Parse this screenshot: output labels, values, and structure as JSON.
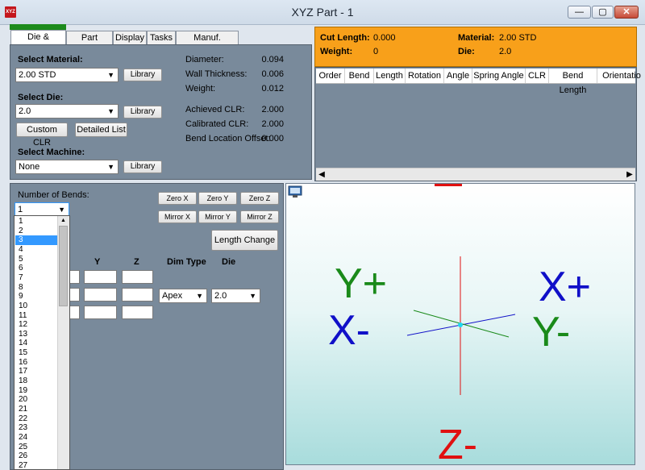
{
  "window": {
    "title": "XYZ Part - 1",
    "icon_text": "XYZ",
    "minimize": "—",
    "maximize": "▢",
    "close": "✕"
  },
  "tabs": [
    "Die & Material",
    "Part Details",
    "Display",
    "Tasks",
    "Manuf. Warning"
  ],
  "material_section": {
    "select_material_label": "Select Material:",
    "material_value": "2.00 STD",
    "library_label": "Library",
    "select_die_label": "Select Die:",
    "die_value": "2.0",
    "custom_clr_label": "Custom CLR",
    "detailed_list_label": "Detailed List",
    "select_machine_label": "Select Machine:",
    "machine_value": "None"
  },
  "properties": {
    "diameter_label": "Diameter:",
    "diameter_value": "0.094",
    "wall_label": "Wall Thickness:",
    "wall_value": "0.006",
    "weight_label": "Weight:",
    "weight_value": "0.012",
    "achieved_label": "Achieved CLR:",
    "achieved_value": "2.000",
    "calibrated_label": "Calibrated CLR:",
    "calibrated_value": "2.000",
    "offset_label": "Bend Location Offset:",
    "offset_value": "0.000"
  },
  "info": {
    "cut_length_label": "Cut Length:",
    "cut_length_value": "0.000",
    "weight_label": "Weight:",
    "weight_value": "0",
    "material_label": "Material:",
    "material_value": "2.00 STD",
    "die_label": "Die:",
    "die_value": "2.0"
  },
  "table": {
    "columns": [
      "Order",
      "Bend",
      "Length",
      "Rotation",
      "Angle",
      "Spring Angle",
      "CLR",
      "Bend Length",
      "Orientatio"
    ]
  },
  "bends": {
    "label": "Number of Bends:",
    "selected": "1",
    "options": [
      "1",
      "2",
      "3",
      "4",
      "5",
      "6",
      "7",
      "8",
      "9",
      "10",
      "11",
      "12",
      "13",
      "14",
      "15",
      "16",
      "17",
      "18",
      "19",
      "20",
      "21",
      "22",
      "23",
      "24",
      "25",
      "26",
      "27"
    ],
    "highlighted_index": 2
  },
  "transform_buttons": {
    "zero_x": "Zero X",
    "zero_y": "Zero Y",
    "zero_z": "Zero Z",
    "mirror_x": "Mirror X",
    "mirror_y": "Mirror Y",
    "mirror_z": "Mirror Z",
    "length_change": "Length Change"
  },
  "grid_headers": {
    "y": "Y",
    "z": "Z",
    "dim_type": "Dim Type",
    "die": "Die"
  },
  "row_values": {
    "dim_type": "Apex",
    "die": "2.0"
  },
  "view3d": {
    "y_plus": "Y+",
    "x_plus": "X+",
    "x_minus": "X-",
    "y_minus": "Y-",
    "z_minus": "Z-"
  },
  "colors": {
    "accent_orange": "#f8a01a",
    "panel": "#798a9b",
    "axis_green": "#1a8a1a",
    "axis_blue": "#1010c8",
    "axis_red": "#e01010"
  }
}
